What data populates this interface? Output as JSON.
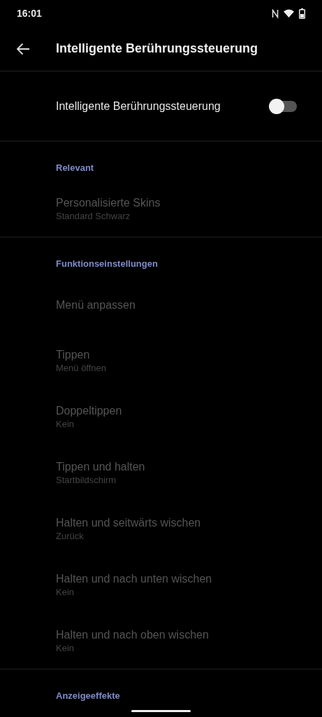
{
  "status_bar": {
    "time": "16:01"
  },
  "app_bar": {
    "title": "Intelligente Berührungssteuerung"
  },
  "master_switch": {
    "label": "Intelligente Berührungssteuerung",
    "on": false
  },
  "sections": [
    {
      "header": "Relevant",
      "items": [
        {
          "title": "Personalisierte Skins",
          "subtitle": "Standard Schwarz",
          "disabled": true
        }
      ]
    },
    {
      "header": "Funktionseinstellungen",
      "items": [
        {
          "title": "Menü anpassen",
          "disabled": true
        },
        {
          "title": "Tippen",
          "subtitle": "Menü öffnen",
          "disabled": true
        },
        {
          "title": "Doppeltippen",
          "subtitle": "Kein",
          "disabled": true
        },
        {
          "title": "Tippen und halten",
          "subtitle": "Startbildschirm",
          "disabled": true
        },
        {
          "title": "Halten und seitwärts wischen",
          "subtitle": "Zurück",
          "disabled": true
        },
        {
          "title": "Halten und nach unten wischen",
          "subtitle": "Kein",
          "disabled": true
        },
        {
          "title": "Halten und nach oben wischen",
          "subtitle": "Kein",
          "disabled": true
        }
      ]
    },
    {
      "header": "Anzeigeeffekte"
    }
  ]
}
